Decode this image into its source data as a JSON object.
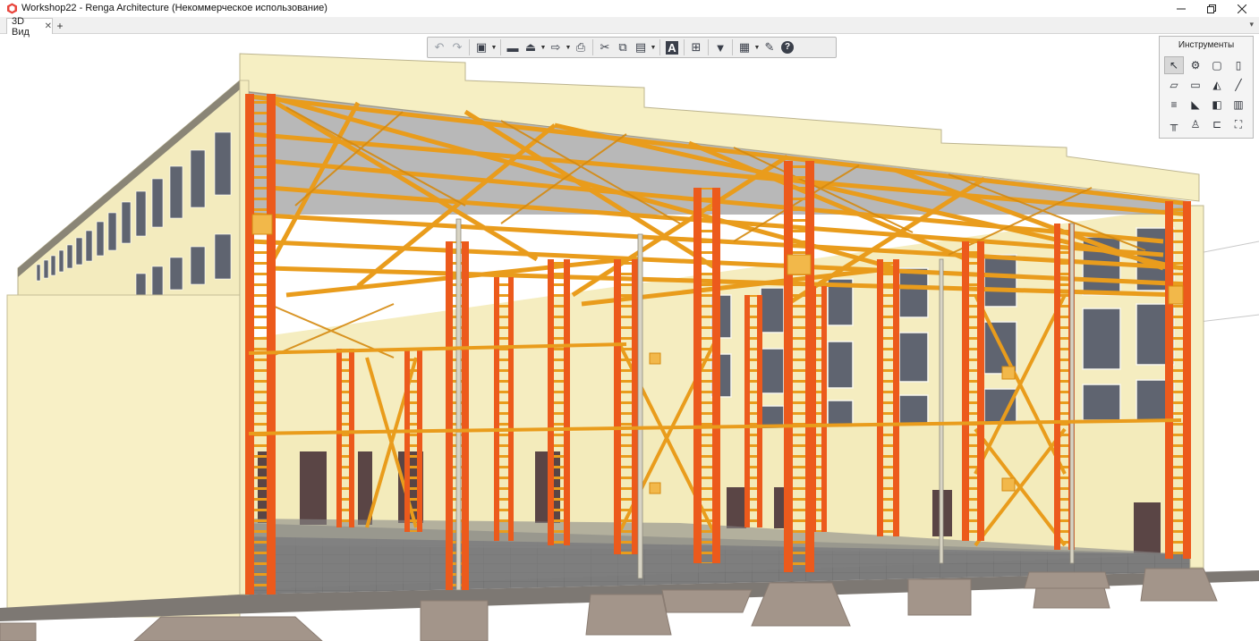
{
  "window": {
    "title": "Workshop22 - Renga Architecture (Некоммерческое использование)",
    "minimize_icon": "minimize-icon",
    "maximize_icon": "restore-icon",
    "close_icon": "close-icon"
  },
  "tabs": {
    "items": [
      {
        "label": "3D Вид",
        "close": "✕"
      }
    ],
    "add": "+",
    "dropdown": "▾"
  },
  "toolbar": {
    "buttons": [
      {
        "name": "undo-icon",
        "glyph": "↶",
        "enabled": false
      },
      {
        "name": "redo-icon",
        "glyph": "↷",
        "enabled": false
      },
      {
        "name": "view-cube-icon",
        "glyph": "▣",
        "enabled": true
      },
      {
        "name": "open-folder-icon",
        "glyph": "▬",
        "enabled": true
      },
      {
        "name": "import-icon",
        "glyph": "⏏",
        "enabled": true
      },
      {
        "name": "export-icon",
        "glyph": "⇨",
        "enabled": true
      },
      {
        "name": "print-icon",
        "glyph": "⎙",
        "enabled": true
      },
      {
        "name": "cut-icon",
        "glyph": "✂",
        "enabled": true
      },
      {
        "name": "copy-icon",
        "glyph": "⧉",
        "enabled": true
      },
      {
        "name": "paste-icon",
        "glyph": "▤",
        "enabled": true
      },
      {
        "name": "text-style-icon",
        "glyph": "A",
        "enabled": true
      },
      {
        "name": "layers-icon",
        "glyph": "⊞",
        "enabled": true
      },
      {
        "name": "filter-icon",
        "glyph": "▼",
        "enabled": true
      },
      {
        "name": "properties-icon",
        "glyph": "▦",
        "enabled": true
      },
      {
        "name": "settings-wrench-icon",
        "glyph": "✎",
        "enabled": true
      },
      {
        "name": "help-icon",
        "glyph": "?",
        "enabled": true
      }
    ]
  },
  "tools": {
    "title": "Инструменты",
    "items": [
      {
        "name": "select-tool-icon",
        "glyph": "↖",
        "active": true
      },
      {
        "name": "assembly-tool-icon",
        "glyph": "⚙",
        "active": false
      },
      {
        "name": "column-tool-icon",
        "glyph": "▢",
        "active": false
      },
      {
        "name": "beam-tool-icon",
        "glyph": "▯",
        "active": false
      },
      {
        "name": "slab-tool-icon",
        "glyph": "▱",
        "active": false
      },
      {
        "name": "opening-tool-icon",
        "glyph": "▭",
        "active": false
      },
      {
        "name": "roof-tool-icon",
        "glyph": "◭",
        "active": false
      },
      {
        "name": "line-tool-icon",
        "glyph": "╱",
        "active": false
      },
      {
        "name": "stair-tool-icon",
        "glyph": "≡",
        "active": false
      },
      {
        "name": "ramp-tool-icon",
        "glyph": "◣",
        "active": false
      },
      {
        "name": "door-tool-icon",
        "glyph": "◧",
        "active": false
      },
      {
        "name": "window-tool-icon",
        "glyph": "▥",
        "active": false
      },
      {
        "name": "railing-tool-icon",
        "glyph": "╥",
        "active": false
      },
      {
        "name": "equipment-tool-icon",
        "glyph": "♙",
        "active": false
      },
      {
        "name": "pipe-tool-icon",
        "glyph": "⊏",
        "active": false
      },
      {
        "name": "element-tool-icon",
        "glyph": "⛶",
        "active": false
      }
    ]
  },
  "colors": {
    "wall": "#f6efc3",
    "column": "#ec5a1c",
    "truss": "#e99c1c",
    "floor": "#7a7a7a",
    "door": "#5a4545",
    "footing": "#a3958a"
  }
}
